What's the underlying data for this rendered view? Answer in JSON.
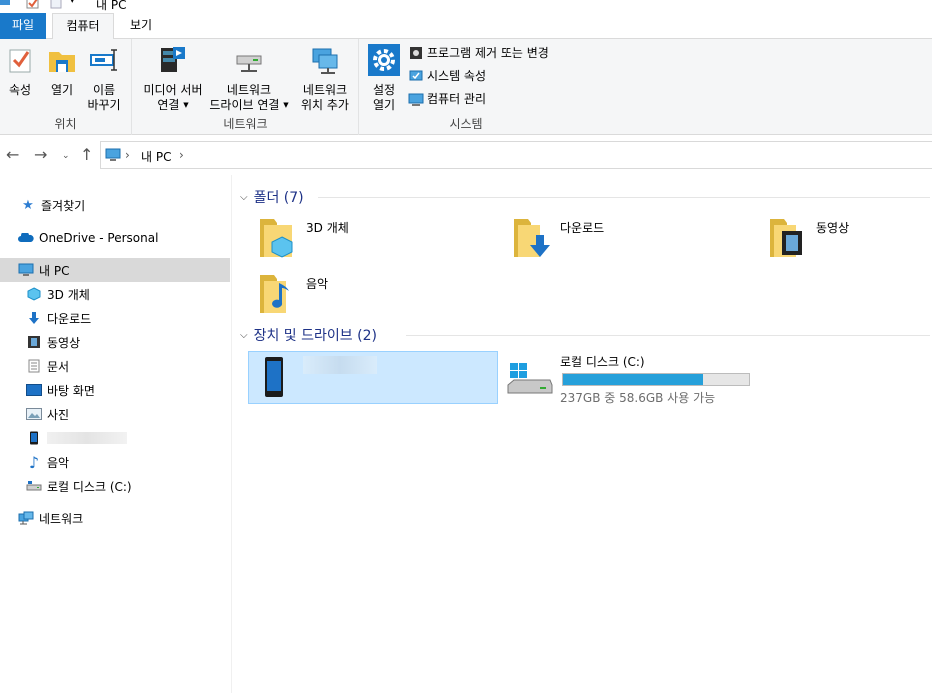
{
  "window": {
    "title": "내 PC"
  },
  "ribbon": {
    "tabs": [
      {
        "label": "파일"
      },
      {
        "label": "컴퓨터"
      },
      {
        "label": "보기"
      }
    ],
    "location": {
      "label": "위치",
      "properties": "속성",
      "open": "열기",
      "rename_line1": "이름",
      "rename_line2": "바꾸기"
    },
    "network": {
      "label": "네트워크",
      "media_line1": "미디어 서버",
      "media_line2": "연결",
      "map_line1": "네트워크",
      "map_line2": "드라이브 연결",
      "add_line1": "네트워크",
      "add_line2": "위치 추가"
    },
    "system": {
      "label": "시스템",
      "settings_line1": "설정",
      "settings_line2": "열기",
      "uninstall": "프로그램 제거 또는 변경",
      "sysprops": "시스템 속성",
      "manage": "컴퓨터 관리"
    }
  },
  "address": {
    "crumb": "내 PC"
  },
  "sidebar": {
    "items": [
      {
        "label": "즐겨찾기"
      },
      {
        "label": "OneDrive - Personal"
      },
      {
        "label": "내 PC"
      },
      {
        "label": "3D 개체"
      },
      {
        "label": "다운로드"
      },
      {
        "label": "동영상"
      },
      {
        "label": "문서"
      },
      {
        "label": "바탕 화면"
      },
      {
        "label": "사진"
      },
      {
        "label": ""
      },
      {
        "label": "음악"
      },
      {
        "label": "로컬 디스크 (C:)"
      },
      {
        "label": "네트워크"
      }
    ]
  },
  "content": {
    "folders_header": "폴더 (7)",
    "folders": [
      {
        "label": "3D 개체"
      },
      {
        "label": "다운로드"
      },
      {
        "label": "동영상"
      },
      {
        "label": "음악"
      }
    ],
    "devices_header": "장치 및 드라이브 (2)",
    "phone_label": "",
    "disk": {
      "label": "로컬 디스크 (C:)",
      "usage_text": "237GB 중 58.6GB 사용 가능",
      "used_fraction": 0.753
    }
  },
  "colors": {
    "accent": "#1979ca",
    "selection": "#cce8ff",
    "bar_fill": "#26a0da"
  }
}
